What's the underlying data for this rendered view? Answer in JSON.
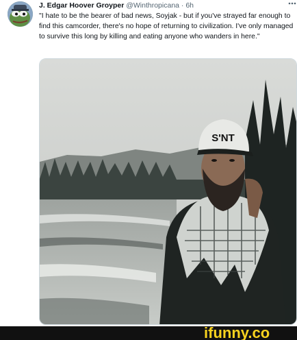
{
  "tweet": {
    "author_name": "J. Edgar Hoover Groyper",
    "author_handle": "@Winthropicana",
    "separator": "·",
    "timestamp": "6h",
    "text": "\"I hate to be the bearer of bad news, Soyjak - but if you've strayed far enough to find this camcorder, there's no hope of returning to civilization. I've only managed to survive this long by killing and eating anyone who wanders in here.\"",
    "hat_text": "S'NT"
  },
  "watermark": {
    "brand": "ifunny.co"
  },
  "icons": {
    "more": "more-options-icon",
    "avatar": "pepe-avatar-icon"
  },
  "colors": {
    "text_primary": "#0f1419",
    "text_secondary": "#536471",
    "watermark_yellow": "#f7d21f",
    "footer_bg": "#111111"
  }
}
